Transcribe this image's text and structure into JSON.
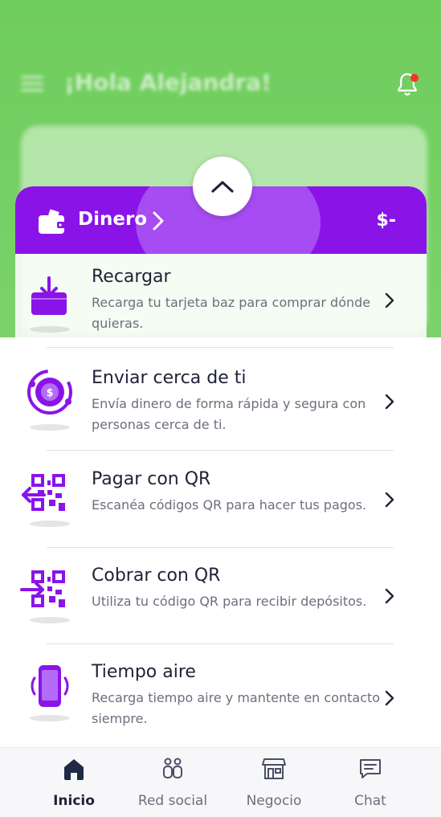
{
  "background": {
    "greeting": "¡Hola Alejandra!"
  },
  "sheet": {
    "section_title": "Dinero",
    "balance": "$-",
    "items": [
      {
        "title": "Recargar",
        "description": "Recarga tu tarjeta baz para comprar dónde quieras.",
        "icon": "wallet-recharge-icon"
      },
      {
        "title": "Enviar cerca de ti",
        "description": "Envía dinero de forma rápida y segura con personas cerca de ti.",
        "icon": "nearby-send-icon"
      },
      {
        "title": "Pagar con QR",
        "description": "Escanéa códigos QR para hacer tus pagos.",
        "icon": "qr-pay-icon"
      },
      {
        "title": "Cobrar con QR",
        "description": "Utiliza tu código QR para recibir depósitos.",
        "icon": "qr-charge-icon"
      },
      {
        "title": "Tiempo aire",
        "description": "Recarga tiempo aire y mantente en contacto siempre.",
        "icon": "phone-airtime-icon"
      }
    ]
  },
  "bottom_nav": [
    {
      "label": "Inicio",
      "icon": "home-icon",
      "active": true
    },
    {
      "label": "Red social",
      "icon": "people-icon",
      "active": false
    },
    {
      "label": "Negocio",
      "icon": "store-icon",
      "active": false
    },
    {
      "label": "Chat",
      "icon": "chat-icon",
      "active": false
    }
  ],
  "colors": {
    "brand_purple": "#8a14e8",
    "header_green": "#6fcd5c",
    "notification_dot": "#ff2e2e"
  }
}
